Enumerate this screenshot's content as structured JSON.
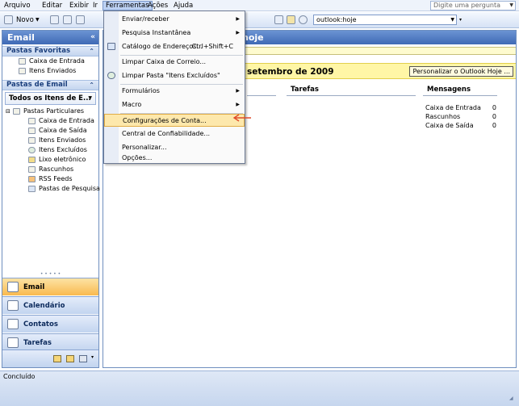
{
  "menubar": {
    "items": [
      "Arquivo",
      "Editar",
      "Exibir",
      "Ir",
      "Ferramentas",
      "Ações",
      "Ajuda"
    ],
    "help_placeholder": "Digite uma pergunta"
  },
  "toolbar": {
    "new_label": "Novo",
    "address_value": "outlook:hoje"
  },
  "nav": {
    "title": "Email",
    "favorites": {
      "title": "Pastas Favoritas",
      "items": [
        "Caixa de Entrada",
        "Itens Enviados"
      ]
    },
    "mail_folders": {
      "title": "Pastas de Email",
      "view": "Todos os Itens de E...",
      "root": "Pastas Particulares",
      "items": [
        "Caixa de Entrada",
        "Caixa de Saída",
        "Itens Enviados",
        "Itens Excluídos",
        "Lixo eletrônico",
        "Rascunhos",
        "RSS Feeds",
        "Pastas de Pesquisa"
      ]
    },
    "buttons": [
      "Email",
      "Calendário",
      "Contatos",
      "Tarefas"
    ]
  },
  "content": {
    "title_suffix": "hoje",
    "date_fragment": "setembro de 2009",
    "customize_label": "Personalizar o Outlook Hoje ...",
    "tasks_header": "Tarefas",
    "messages_header": "Mensagens",
    "messages": [
      {
        "label": "Caixa de Entrada",
        "count": "0"
      },
      {
        "label": "Rascunhos",
        "count": "0"
      },
      {
        "label": "Caixa de Saída",
        "count": "0"
      }
    ]
  },
  "menu": {
    "items": [
      {
        "label": "Enviar/receber",
        "submenu": true
      },
      {
        "label": "Pesquisa Instantânea",
        "submenu": true
      },
      {
        "label": "Catálogo de Endereços...",
        "shortcut": "Ctrl+Shift+C"
      },
      {
        "label": "Limpar Caixa de Correio..."
      },
      {
        "label": "Limpar Pasta \"Itens Excluídos\""
      },
      {
        "label": "Formulários",
        "submenu": true
      },
      {
        "label": "Macro",
        "submenu": true
      },
      {
        "label": "Configurações de Conta..."
      },
      {
        "label": "Central de Confiabilidade..."
      },
      {
        "label": "Personalizar..."
      },
      {
        "label": "Opções..."
      }
    ]
  },
  "status": {
    "text": "Concluído"
  }
}
